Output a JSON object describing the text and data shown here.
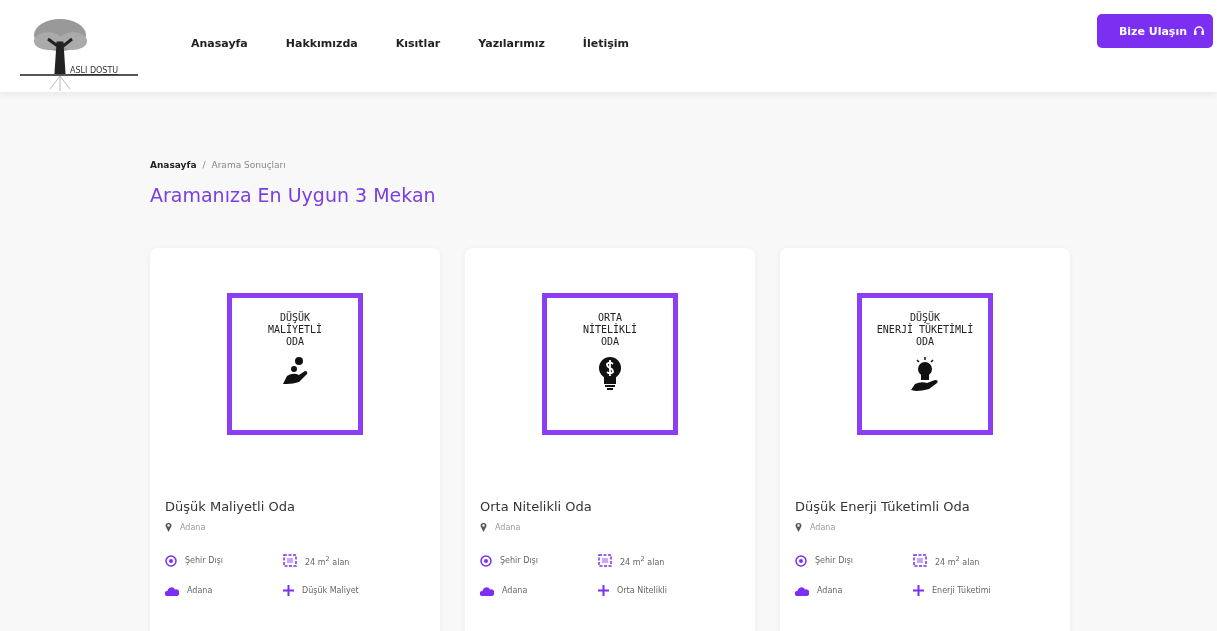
{
  "logo": {
    "text": "ASLI DOSTU"
  },
  "nav": [
    {
      "label": "Anasayfa"
    },
    {
      "label": "Hakkımızda"
    },
    {
      "label": "Kısıtlar"
    },
    {
      "label": "Yazılarımız"
    },
    {
      "label": "İletişim"
    }
  ],
  "contact_button": {
    "label": "Bize Ulaşın"
  },
  "breadcrumb": {
    "home": "Anasayfa",
    "separator": "/",
    "current": "Arama Sonuçları"
  },
  "heading": "Aramanıza En Uygun 3 Mekan",
  "cards": [
    {
      "image": {
        "lines": [
          "DÜŞÜK",
          "MALİYETLİ",
          "ODA"
        ],
        "kind": "coin"
      },
      "title": "Düşük Maliyetli Oda",
      "location": "Adana",
      "features": [
        {
          "kind": "target",
          "text": "Şehir Dışı"
        },
        {
          "kind": "area",
          "text": "24 m$^{2}$ alan"
        },
        {
          "kind": "cloud",
          "text": "Adana"
        },
        {
          "kind": "plus",
          "text": "Düşük Maliyet"
        }
      ]
    },
    {
      "image": {
        "lines": [
          "ORTA",
          "NİTELİKLİ",
          "ODA"
        ],
        "kind": "bulb"
      },
      "title": "Orta Nitelikli Oda",
      "location": "Adana",
      "features": [
        {
          "kind": "target",
          "text": "Şehir Dışı"
        },
        {
          "kind": "area",
          "text": "24 m$^{2}$ alan"
        },
        {
          "kind": "cloud",
          "text": "Adana"
        },
        {
          "kind": "plus",
          "text": "Orta Nitelikli"
        }
      ]
    },
    {
      "image": {
        "lines": [
          "DÜŞÜK",
          "ENERJİ TÜKETİMLİ",
          "ODA"
        ],
        "kind": "energy"
      },
      "title": "Düşük Enerji Tüketimli Oda",
      "location": "Adana",
      "features": [
        {
          "kind": "target",
          "text": "Şehir Dışı"
        },
        {
          "kind": "area",
          "text": "24 m$^{2}$ alan"
        },
        {
          "kind": "cloud",
          "text": "Adana"
        },
        {
          "kind": "plus",
          "text": "Enerji Tüketimi"
        }
      ]
    }
  ]
}
